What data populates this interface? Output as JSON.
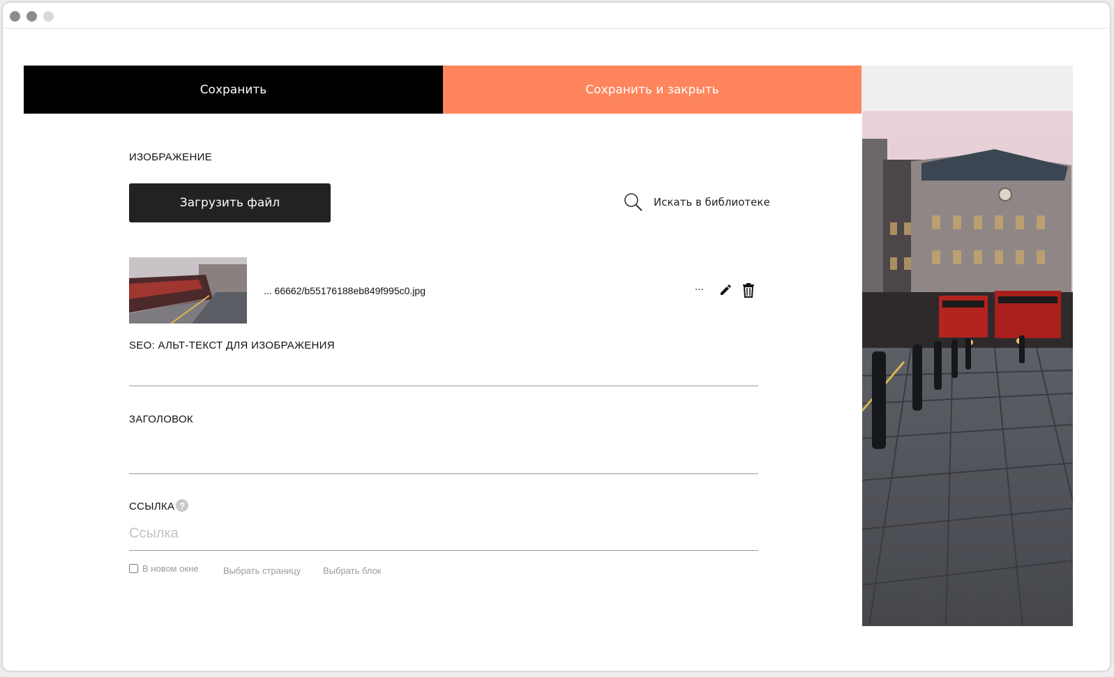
{
  "window": {
    "controls": [
      "close",
      "minimize",
      "zoom"
    ]
  },
  "toolbar": {
    "save_label": "Сохранить",
    "save_close_label": "Сохранить и закрыть",
    "accent_color": "#ff855d"
  },
  "image_section": {
    "label": "ИЗОБРАЖЕНИЕ",
    "upload_label": "Загрузить файл",
    "library_label": "Искать в библиотеке",
    "library_icon": "search-icon",
    "file": {
      "name": "... 66662/b55176188eb849f995c0.jpg",
      "more_label": "...",
      "edit_icon": "pencil-icon",
      "delete_icon": "trash-icon"
    }
  },
  "alt_section": {
    "label": "SEO: АЛЬТ-ТЕКСТ ДЛЯ ИЗОБРАЖЕНИЯ",
    "value": ""
  },
  "title_section": {
    "label": "ЗАГОЛОВОК",
    "value": ""
  },
  "link_section": {
    "label": "ССЫЛКА",
    "help_icon": "question-icon",
    "help_symbol": "?",
    "placeholder": "Ссылка",
    "value": "",
    "new_window_label": "В новом окне",
    "new_window_checked": false,
    "choose_page_label": "Выбрать страницу",
    "choose_block_label": "Выбрать блок"
  }
}
